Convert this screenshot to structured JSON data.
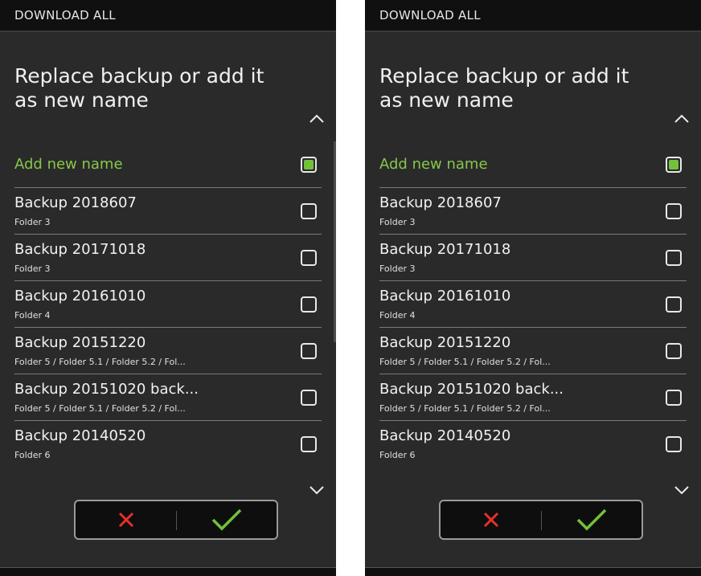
{
  "header": {
    "title": "DOWNLOAD ALL"
  },
  "dialog": {
    "heading": "Replace backup or add it as new name"
  },
  "add_item": {
    "label": "Add new name",
    "checked": true
  },
  "backups": [
    {
      "title": "Backup 2018607",
      "subtitle": "Folder 3"
    },
    {
      "title": "Backup 20171018",
      "subtitle": "Folder 3"
    },
    {
      "title": "Backup 20161010",
      "subtitle": "Folder 4"
    },
    {
      "title": "Backup 20151220",
      "subtitle": "Folder 5 / Folder 5.1 / Folder 5.2 / Fol..."
    },
    {
      "title": "Backup 20151020 back...",
      "subtitle": "Folder 5 / Folder 5.1 / Folder 5.2 / Fol..."
    },
    {
      "title": "Backup 20140520",
      "subtitle": "Folder 6"
    }
  ],
  "colors": {
    "accent_green": "#86c84a",
    "cancel_red": "#e8302d",
    "confirm_green": "#73c13a",
    "background": "#2a2a2a"
  },
  "icons": {
    "scroll_up": "chevron-up-icon",
    "scroll_down": "chevron-down-icon",
    "cancel": "close-icon",
    "confirm": "check-icon"
  }
}
